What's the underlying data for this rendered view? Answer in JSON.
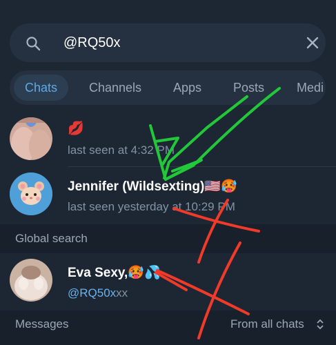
{
  "search": {
    "value": "@RQ50x",
    "search_icon": "search-icon",
    "clear_icon": "close-icon"
  },
  "tabs": [
    {
      "label": "Chats",
      "active": true
    },
    {
      "label": "Channels",
      "active": false
    },
    {
      "label": "Apps",
      "active": false
    },
    {
      "label": "Posts",
      "active": false
    },
    {
      "label": "Medi",
      "active": false
    }
  ],
  "chats": [
    {
      "name": "💋",
      "status": "last seen at 4:32 PM"
    },
    {
      "name": "Jennifer (Wildsexting)🇺🇸🥵",
      "status": "last seen yesterday at 10:29 PM",
      "avatar_icon": "hamster-icon"
    }
  ],
  "global_search": {
    "header": "Global search",
    "results": [
      {
        "name": "Eva Sexy,🥵💦",
        "handle_match": "@RQ50x",
        "handle_rest": "xx"
      }
    ]
  },
  "messages": {
    "header": "Messages",
    "filter_label": "From all chats",
    "filter_icon": "chevron-updown-icon"
  },
  "colors": {
    "background": "#1d2733",
    "accent": "#5ea9e8",
    "annotation_green": "#22c83a",
    "annotation_red": "#f03a2a"
  }
}
